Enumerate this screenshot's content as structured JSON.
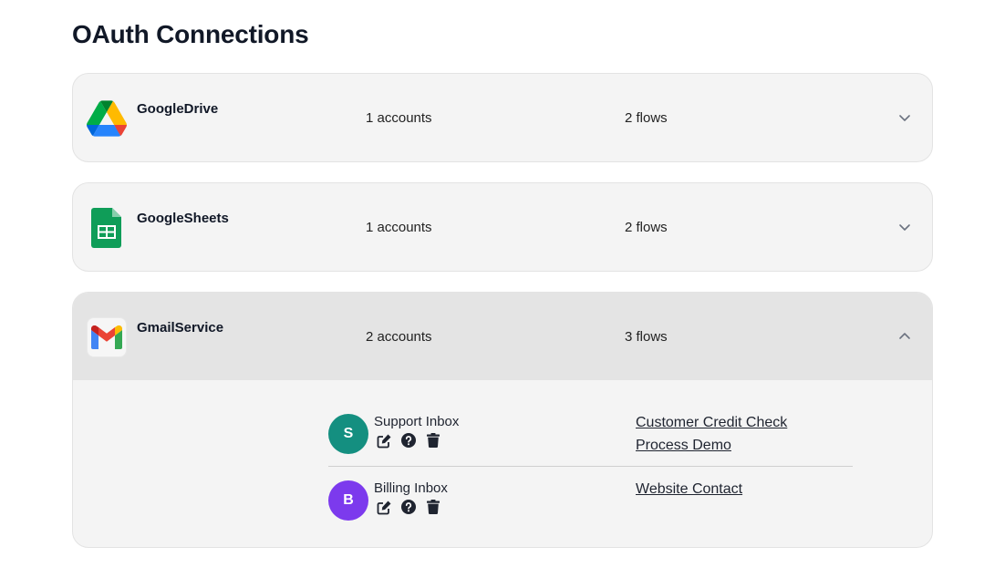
{
  "page": {
    "title": "OAuth Connections"
  },
  "services": [
    {
      "name": "GoogleDrive",
      "logo": "google-drive-logo",
      "accounts": "1 accounts",
      "flows": "2 flows",
      "chevron": "chevron-down-icon"
    },
    {
      "name": "GoogleSheets",
      "logo": "google-sheets-logo",
      "accounts": "1 accounts",
      "flows": "2 flows",
      "chevron": "chevron-down-icon"
    },
    {
      "name": "GmailService",
      "logo": "gmail-logo",
      "accounts": "2 accounts",
      "flows": "3 flows",
      "chevron": "chevron-up-icon"
    }
  ],
  "gmail_accounts": [
    {
      "initial": "S",
      "name": "Support Inbox",
      "avatar_color": "#148f80",
      "actions": [
        "edit-icon",
        "help-icon",
        "trash-icon"
      ],
      "flows": [
        "Customer Credit Check",
        "Process Demo"
      ]
    },
    {
      "initial": "B",
      "name": "Billing Inbox",
      "avatar_color": "#7c3aed",
      "actions": [
        "edit-icon",
        "help-icon",
        "trash-icon"
      ],
      "flows": [
        "Website Contact"
      ]
    }
  ],
  "colors": {
    "card_bg": "#f4f4f4",
    "expanded_header_bg": "#e4e4e4",
    "text": "#1f2430"
  }
}
